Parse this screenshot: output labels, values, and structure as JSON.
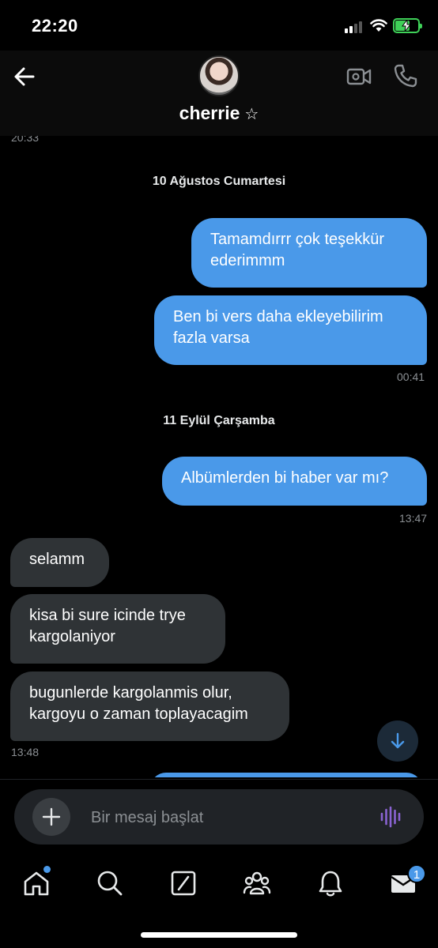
{
  "status_bar": {
    "time": "22:20",
    "battery_color": "#3fd158"
  },
  "header": {
    "back_icon": "arrow-left-icon",
    "contact_name": "cherrie",
    "star": "☆",
    "video_icon": "video-camera-icon",
    "call_icon": "phone-icon"
  },
  "chat": {
    "top_timestamp": "20:33",
    "dates": {
      "first": "10 Ağustos Cumartesi",
      "second": "11 Eylül Çarşamba"
    },
    "messages": [
      {
        "direction": "outgoing",
        "text": "Tamamdırrr çok teşekkür ederimmm"
      },
      {
        "direction": "outgoing",
        "text": "Ben bi vers daha ekleyebilirim fazla varsa",
        "time": "00:41"
      },
      {
        "direction": "outgoing",
        "text": "Albümlerden bi haber var mı?",
        "time": "13:47"
      },
      {
        "direction": "incoming",
        "text": "selamm"
      },
      {
        "direction": "incoming",
        "text": "kisa bi sure icinde trye kargolaniyor"
      },
      {
        "direction": "incoming",
        "text": "bugunlerde kargolanmis olur, kargoyu o zaman toplayacagim",
        "time": "13:48"
      }
    ],
    "scroll_icon": "arrow-down-icon"
  },
  "composer": {
    "add_icon": "plus-icon",
    "placeholder": "Bir mesaj başlat",
    "voice_icon": "voice-waveform-icon"
  },
  "tabbar": {
    "items": [
      "home-icon",
      "search-icon",
      "grok-icon",
      "communities-icon",
      "notifications-icon",
      "messages-icon"
    ],
    "messages_badge": "1"
  },
  "colors": {
    "accent": "#4a99e9",
    "incoming_bubble": "#2f3336",
    "background": "#000000"
  }
}
